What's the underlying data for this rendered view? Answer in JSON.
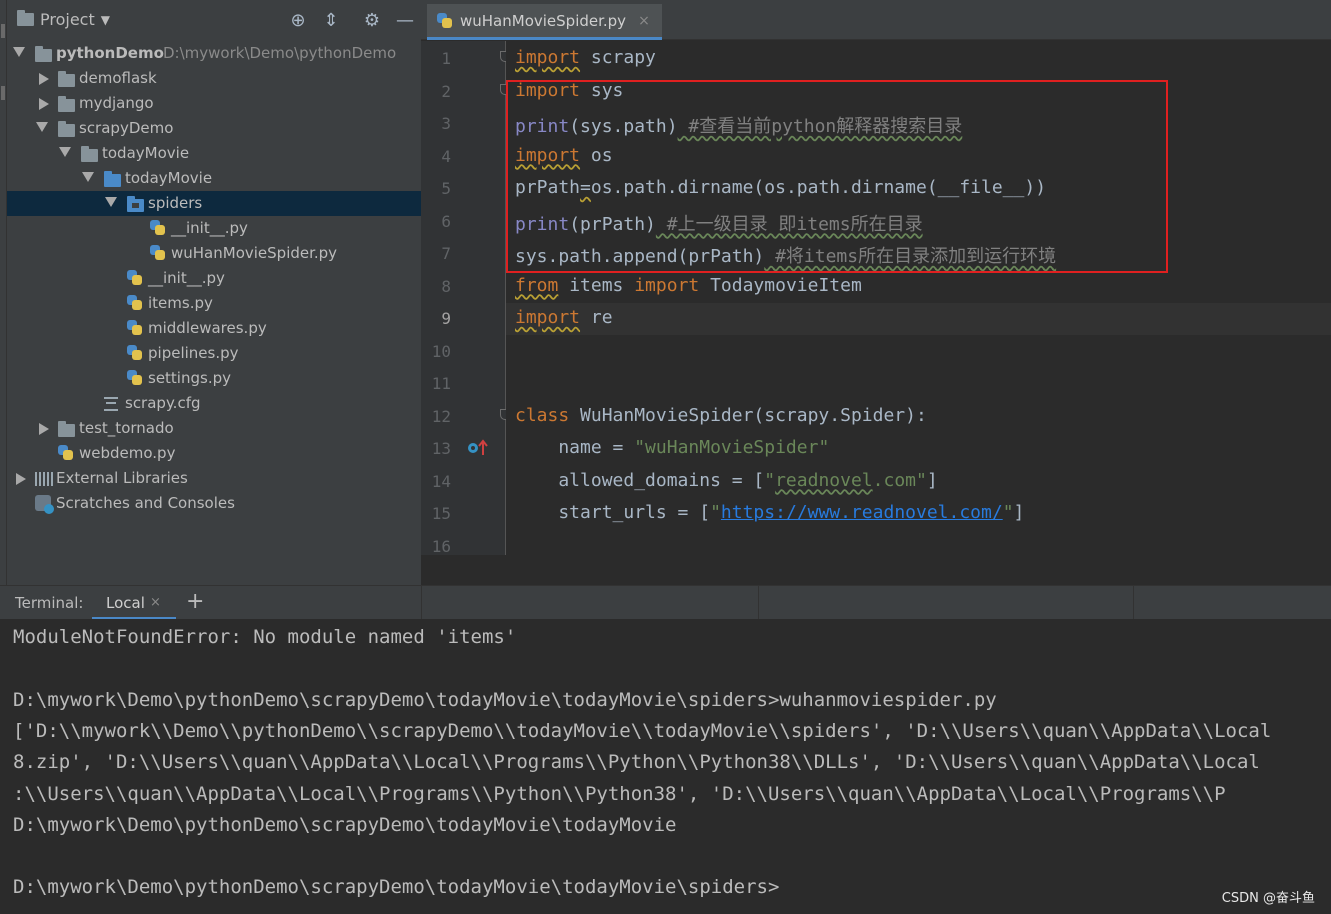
{
  "project_panel": {
    "title": "Project",
    "tree": [
      {
        "name": "pythonDemo",
        "path": "D:\\mywork\\Demo\\pythonDemo",
        "kind": "root",
        "state": "expanded",
        "level": 0
      },
      {
        "name": "demoflask",
        "kind": "folder",
        "state": "collapsed",
        "level": 1
      },
      {
        "name": "mydjango",
        "kind": "folder",
        "state": "collapsed",
        "level": 1
      },
      {
        "name": "scrapyDemo",
        "kind": "folder",
        "state": "expanded",
        "level": 1
      },
      {
        "name": "todayMovie",
        "kind": "folder",
        "state": "expanded",
        "level": 2
      },
      {
        "name": "todayMovie",
        "kind": "package",
        "state": "expanded",
        "level": 3
      },
      {
        "name": "spiders",
        "kind": "package",
        "state": "expanded",
        "level": 4,
        "selected": true
      },
      {
        "name": "__init__.py",
        "kind": "py",
        "level": 5
      },
      {
        "name": "wuHanMovieSpider.py",
        "kind": "py",
        "level": 5
      },
      {
        "name": "__init__.py",
        "kind": "py",
        "level": 4
      },
      {
        "name": "items.py",
        "kind": "py",
        "level": 4
      },
      {
        "name": "middlewares.py",
        "kind": "py",
        "level": 4
      },
      {
        "name": "pipelines.py",
        "kind": "py",
        "level": 4
      },
      {
        "name": "settings.py",
        "kind": "py",
        "level": 4
      },
      {
        "name": "scrapy.cfg",
        "kind": "cfg",
        "level": 3
      },
      {
        "name": "test_tornado",
        "kind": "folder",
        "state": "collapsed",
        "level": 1
      },
      {
        "name": "webdemo.py",
        "kind": "py",
        "level": 1
      },
      {
        "name": "External Libraries",
        "kind": "lib",
        "state": "collapsed",
        "level": 0
      },
      {
        "name": "Scratches and Consoles",
        "kind": "scratch",
        "level": 0
      }
    ]
  },
  "editor": {
    "tab_label": "wuHanMovieSpider.py",
    "tab_close": "×",
    "current_line": 9,
    "lines": [
      {
        "n": "1",
        "tokens": [
          {
            "t": "import",
            "c": "kw warn"
          },
          {
            "t": " scrapy",
            "c": ""
          }
        ]
      },
      {
        "n": "2",
        "tokens": [
          {
            "t": "import",
            "c": "kw"
          },
          {
            "t": " sys",
            "c": ""
          }
        ]
      },
      {
        "n": "3",
        "tokens": [
          {
            "t": "print",
            "c": "fn"
          },
          {
            "t": "(sys.path)",
            "c": ""
          },
          {
            "t": " #查看当前python解释器搜索目录",
            "c": "cm typo"
          }
        ]
      },
      {
        "n": "4",
        "tokens": [
          {
            "t": "import",
            "c": "kw warn"
          },
          {
            "t": " os",
            "c": ""
          }
        ]
      },
      {
        "n": "5",
        "tokens": [
          {
            "t": "prPath",
            "c": ""
          },
          {
            "t": "=",
            "c": "warn"
          },
          {
            "t": "os.path.dirname(os.path.dirname(__file__))",
            "c": ""
          }
        ]
      },
      {
        "n": "6",
        "tokens": [
          {
            "t": "print",
            "c": "fn"
          },
          {
            "t": "(prPath)",
            "c": ""
          },
          {
            "t": " #上一级目录 即items所在目录",
            "c": "cm typo"
          }
        ]
      },
      {
        "n": "7",
        "tokens": [
          {
            "t": "sys.path.append(prPath)",
            "c": ""
          },
          {
            "t": " #将items所在目录添加到运行环境",
            "c": "cm typo"
          }
        ]
      },
      {
        "n": "8",
        "tokens": [
          {
            "t": "from",
            "c": "kw warn"
          },
          {
            "t": " items ",
            "c": ""
          },
          {
            "t": "import",
            "c": "kw"
          },
          {
            "t": " TodaymovieItem",
            "c": ""
          }
        ]
      },
      {
        "n": "9",
        "tokens": [
          {
            "t": "import",
            "c": "kw warn"
          },
          {
            "t": " re",
            "c": ""
          }
        ]
      },
      {
        "n": "10",
        "tokens": []
      },
      {
        "n": "11",
        "tokens": []
      },
      {
        "n": "12",
        "tokens": [
          {
            "t": "class",
            "c": "kw"
          },
          {
            "t": " WuHanMovieSpider(scrapy.Spider):",
            "c": ""
          }
        ]
      },
      {
        "n": "13",
        "tokens": [
          {
            "t": "    name = ",
            "c": ""
          },
          {
            "t": "\"wuHanMovieSpider\"",
            "c": "str"
          }
        ]
      },
      {
        "n": "14",
        "tokens": [
          {
            "t": "    allowed_domains = [",
            "c": ""
          },
          {
            "t": "\"",
            "c": "str"
          },
          {
            "t": "readnovel",
            "c": "str typo"
          },
          {
            "t": ".com\"",
            "c": "str"
          },
          {
            "t": "]",
            "c": ""
          }
        ]
      },
      {
        "n": "15",
        "tokens": [
          {
            "t": "    start_urls = [",
            "c": ""
          },
          {
            "t": "\"",
            "c": "str"
          },
          {
            "t": "https://www.readnovel.com/",
            "c": "link"
          },
          {
            "t": "\"",
            "c": "str"
          },
          {
            "t": "]",
            "c": ""
          }
        ]
      },
      {
        "n": "16",
        "tokens": []
      }
    ]
  },
  "terminal": {
    "label": "Terminal:",
    "tab_label": "Local",
    "tab_close": "×",
    "add_label": "+",
    "lines": [
      "ModuleNotFoundError: No module named 'items'",
      "",
      "D:\\mywork\\Demo\\pythonDemo\\scrapyDemo\\todayMovie\\todayMovie\\spiders>wuhanmoviespider.py",
      "['D:\\\\mywork\\\\Demo\\\\pythonDemo\\\\scrapyDemo\\\\todayMovie\\\\todayMovie\\\\spiders', 'D:\\\\Users\\\\quan\\\\AppData\\\\Local",
      "8.zip', 'D:\\\\Users\\\\quan\\\\AppData\\\\Local\\\\Programs\\\\Python\\\\Python38\\\\DLLs', 'D:\\\\Users\\\\quan\\\\AppData\\\\Local",
      ":\\\\Users\\\\quan\\\\AppData\\\\Local\\\\Programs\\\\Python\\\\Python38', 'D:\\\\Users\\\\quan\\\\AppData\\\\Local\\\\Programs\\\\P",
      "D:\\mywork\\Demo\\pythonDemo\\scrapyDemo\\todayMovie\\todayMovie",
      "",
      "D:\\mywork\\Demo\\pythonDemo\\scrapyDemo\\todayMovie\\todayMovie\\spiders>"
    ]
  },
  "watermark": "CSDN @奋斗鱼",
  "colors": {
    "highlight_box": "#e02020",
    "keyword": "#cc7832",
    "builtin": "#8888c6",
    "string": "#6a8759",
    "comment": "#808080",
    "selection": "#0d293e",
    "tab_accent": "#4a88c7"
  }
}
